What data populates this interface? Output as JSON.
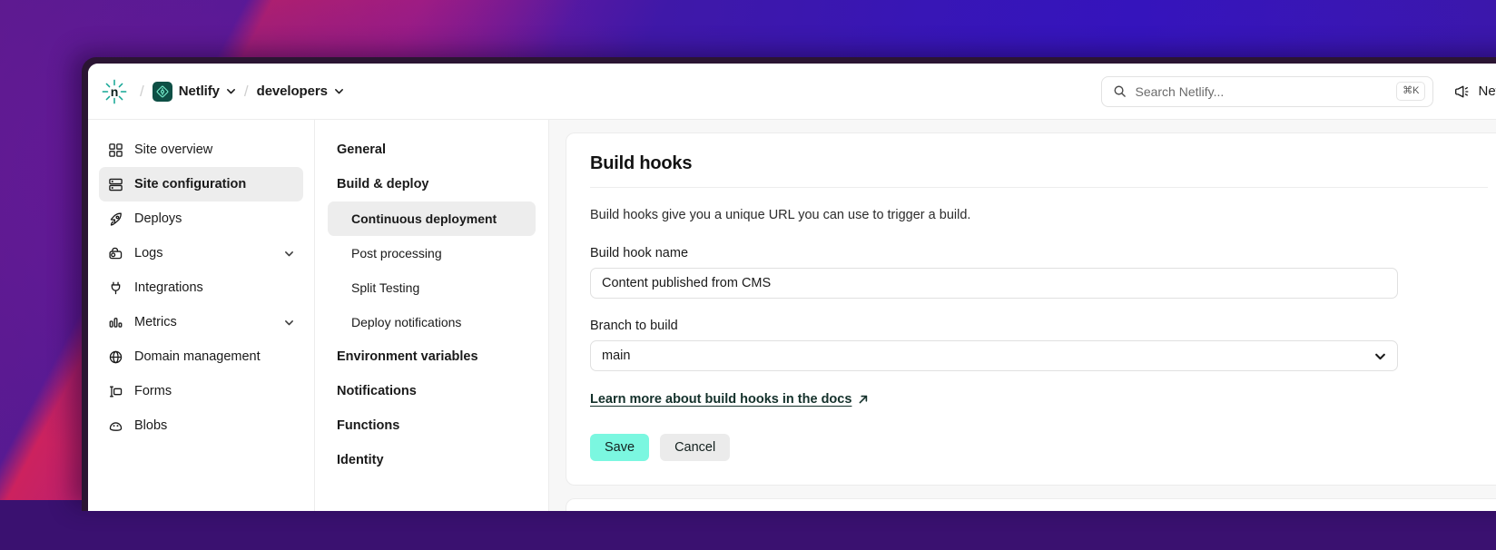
{
  "window": {
    "app": "Netlify"
  },
  "topbar": {
    "logo_icon": "netlify-logo-icon",
    "breadcrumb": [
      {
        "label": "Netlify",
        "icon": "site-avatar-icon",
        "caret": "chevron-down-icon"
      },
      {
        "label": "developers",
        "caret": "chevron-down-icon"
      }
    ],
    "search": {
      "icon": "search-icon",
      "placeholder": "Search Netlify...",
      "value": "",
      "shortcut": "⌘K"
    },
    "news": {
      "icon": "megaphone-icon",
      "label": "News"
    }
  },
  "sidebar": {
    "items": [
      {
        "label": "Site overview",
        "icon": "grid-icon",
        "active": false,
        "caret": false
      },
      {
        "label": "Site configuration",
        "icon": "sliders-icon",
        "active": true,
        "caret": false
      },
      {
        "label": "Deploys",
        "icon": "rocket-icon",
        "active": false,
        "caret": false
      },
      {
        "label": "Logs",
        "icon": "logs-icon",
        "active": false,
        "caret": true
      },
      {
        "label": "Integrations",
        "icon": "plug-icon",
        "active": false,
        "caret": false
      },
      {
        "label": "Metrics",
        "icon": "bar-chart-icon",
        "active": false,
        "caret": true
      },
      {
        "label": "Domain management",
        "icon": "globe-icon",
        "active": false,
        "caret": false
      },
      {
        "label": "Forms",
        "icon": "form-icon",
        "active": false,
        "caret": false
      },
      {
        "label": "Blobs",
        "icon": "blob-icon",
        "active": false,
        "caret": false
      }
    ]
  },
  "subnav": {
    "items": [
      {
        "label": "General",
        "level": "head",
        "active": false
      },
      {
        "label": "Build & deploy",
        "level": "head",
        "active": false,
        "bold": true
      },
      {
        "label": "Continuous deployment",
        "level": "child",
        "active": true
      },
      {
        "label": "Post processing",
        "level": "child",
        "active": false
      },
      {
        "label": "Split Testing",
        "level": "child",
        "active": false
      },
      {
        "label": "Deploy notifications",
        "level": "child",
        "active": false
      },
      {
        "label": "Environment variables",
        "level": "head",
        "active": false
      },
      {
        "label": "Notifications",
        "level": "head",
        "active": false
      },
      {
        "label": "Functions",
        "level": "head",
        "active": false
      },
      {
        "label": "Identity",
        "level": "head",
        "active": false
      }
    ]
  },
  "main": {
    "card": {
      "title": "Build hooks",
      "description": "Build hooks give you a unique URL you can use to trigger a build.",
      "fields": {
        "hook_name": {
          "label": "Build hook name",
          "value": "Content published from CMS",
          "placeholder": "Build hook name"
        },
        "branch": {
          "label": "Branch to build",
          "value": "main",
          "caret_icon": "chevron-down-icon",
          "options": [
            "main"
          ]
        }
      },
      "docs_link": {
        "label": "Learn more about build hooks in the docs",
        "icon": "external-link-arrow-icon"
      },
      "buttons": {
        "save": "Save",
        "cancel": "Cancel"
      }
    }
  },
  "colors": {
    "accent_teal": "#7bf7e0",
    "active_bg": "#ededed",
    "link": "#14312b",
    "avatar_green": "#0e4f45"
  }
}
